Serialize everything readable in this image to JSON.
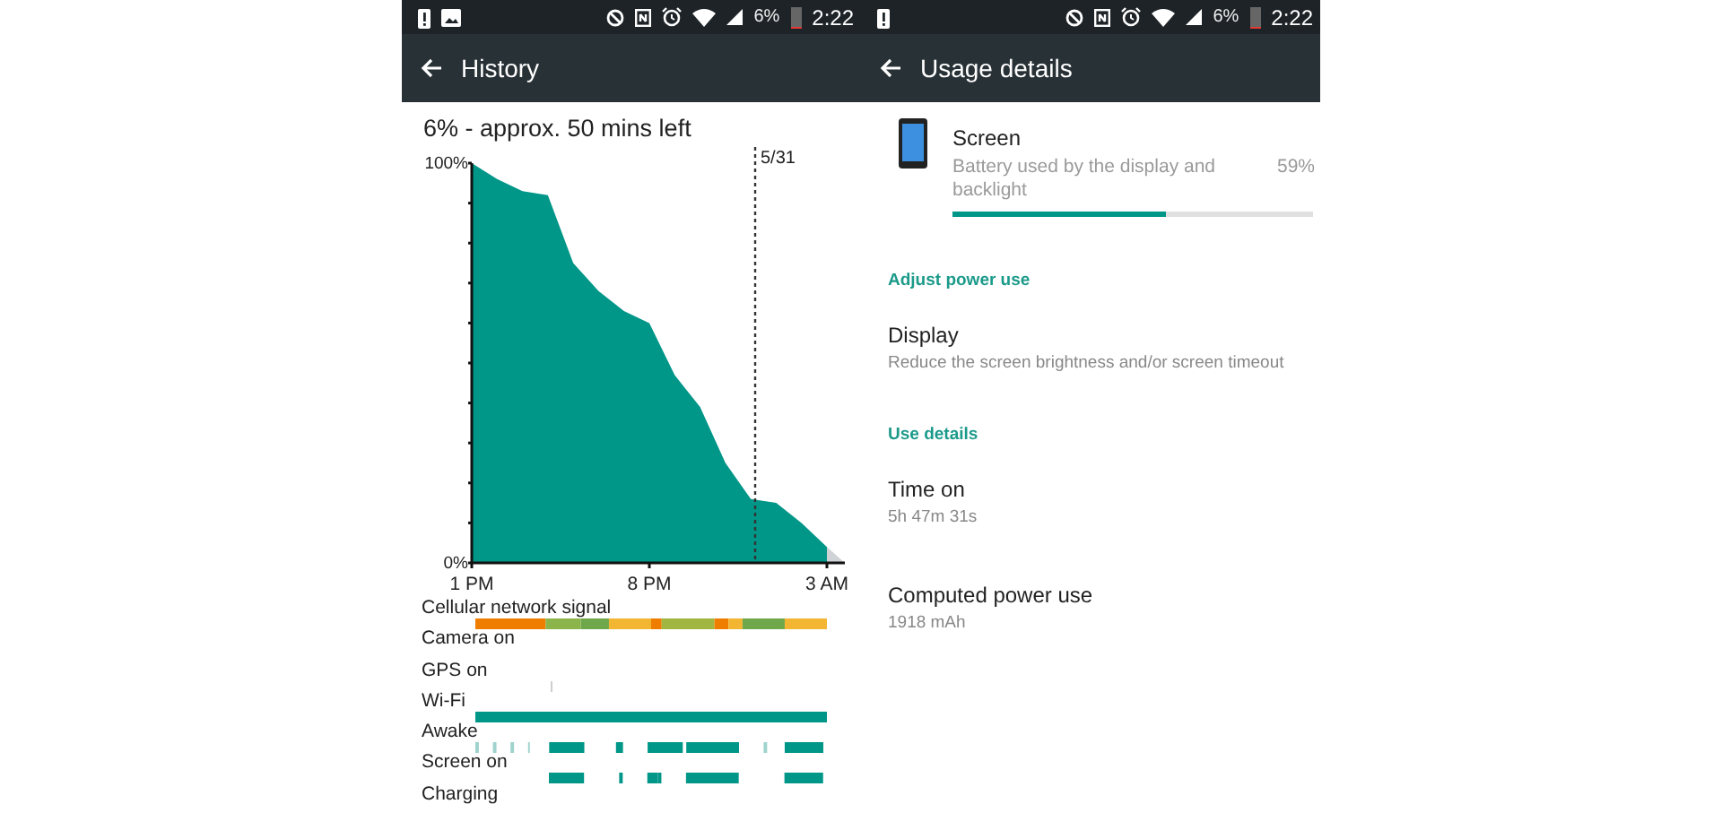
{
  "history_screen": {
    "status_bar": {
      "notifications": [
        {
          "kind": "battery-alert"
        },
        {
          "kind": "image"
        }
      ],
      "battery": "6%",
      "time": "2:22"
    },
    "toolbar": {
      "title": "History"
    },
    "summary": "6% - approx. 50 mins left",
    "chart_data": {
      "type": "area",
      "categories": [
        "1 PM",
        null,
        null,
        null,
        null,
        null,
        null,
        "8 PM",
        null,
        null,
        null,
        null,
        null,
        null,
        "3 AM"
      ],
      "series": [
        {
          "color": "#009688",
          "values": [
            100,
            96,
            93,
            92,
            75,
            68,
            63,
            60,
            47,
            39,
            25,
            16,
            15,
            10,
            4
          ]
        }
      ],
      "ylim": [
        0,
        100
      ],
      "yticks": [
        {
          "value": 0,
          "label": "0%"
        },
        {
          "value": 100,
          "label": "100%"
        }
      ],
      "annotations": [
        "5/31"
      ]
    },
    "timelines": [
      {
        "label": "Cellular network signal",
        "kind": "signal"
      },
      {
        "label": "Camera on",
        "kind": "none"
      },
      {
        "label": "GPS on",
        "kind": "gps"
      },
      {
        "label": "Wi-Fi",
        "kind": "wifi"
      },
      {
        "label": "Awake",
        "kind": "awake"
      },
      {
        "label": "Screen on",
        "kind": "screen"
      },
      {
        "label": "Charging",
        "kind": "none"
      }
    ]
  },
  "usage_screen": {
    "status_bar": {
      "notifications": [
        {
          "kind": "battery-alert"
        }
      ],
      "battery": "6%",
      "time": "2:22"
    },
    "toolbar": {
      "title": "Usage details"
    },
    "app": {
      "name": "Screen",
      "description": "Battery used by the display and backlight",
      "percent": "59%",
      "level": 0.59
    },
    "sections": [
      {
        "heading": "Adjust power use",
        "items": [
          {
            "title": "Display",
            "subtitle": "Reduce the screen brightness and/or screen timeout"
          }
        ]
      },
      {
        "heading": "Use details",
        "items": [
          {
            "title": "Time on",
            "subtitle": "5h 47m 31s"
          },
          {
            "title": "Computed power use",
            "subtitle": "1918 mAh"
          }
        ]
      }
    ]
  }
}
